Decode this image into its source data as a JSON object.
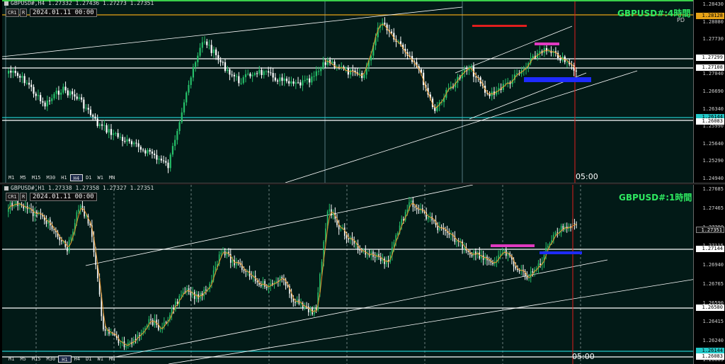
{
  "panels": [
    {
      "header": "GBPUSD#,H4  1.27332 1.27436 1.27273 1.27351",
      "chip_cr": "CR1",
      "chip_r": "R",
      "date": "2024.01.11 00:00",
      "title": "GBPUSD#:4時間",
      "pd": "PD",
      "time": "05:00",
      "timeframes": [
        "M1",
        "M5",
        "M15",
        "M30",
        "H1",
        "H4",
        "D1",
        "W1",
        "MN"
      ],
      "active_tf": "H4",
      "ticks": [
        "1.28430",
        "1.28080",
        "1.27730",
        "1.27380",
        "1.27040",
        "1.26690",
        "1.26340",
        "1.25990",
        "1.25640",
        "1.25290",
        "1.24940"
      ],
      "tags": [
        {
          "text": "1.28128",
          "color": "y"
        },
        {
          "text": "1.27299",
          "color": "w"
        },
        {
          "text": "1.27108",
          "color": "w"
        },
        {
          "text": "1.26144",
          "color": "c"
        },
        {
          "text": "1.26083",
          "color": "w"
        }
      ]
    },
    {
      "header": "GBPUSD#,H1  1.27338 1.27358 1.27327 1.27351",
      "chip_cr": "CR1",
      "chip_r": "R",
      "date": "2024.01.11 00:00",
      "title": "GBPUSD#:1時間",
      "time": "05:00",
      "timeframes": [
        "M1",
        "M5",
        "M15",
        "M30",
        "H1",
        "H4",
        "D1",
        "W1",
        "MN"
      ],
      "active_tf": "H1",
      "ticks": [
        "1.27685",
        "1.27465",
        "1.27290",
        "1.27115",
        "1.26940",
        "1.26765",
        "1.26590",
        "1.26415",
        "1.26240",
        "1.26065"
      ],
      "tags": [
        {
          "text": "1.27351",
          "color": "k"
        },
        {
          "text": "1.27144",
          "color": "w"
        },
        {
          "text": "1.26580",
          "color": "w"
        },
        {
          "text": "1.26144",
          "color": "c"
        },
        {
          "text": "1.26083",
          "color": "w"
        }
      ]
    }
  ],
  "colors": {
    "bull": "#26c06a",
    "bear": "#ffffff",
    "bg": "#021a17",
    "hline": "#ffffff",
    "cyanline": "#22c7c7",
    "orangeline": "#e8a317",
    "ma": "#e8952a",
    "red": "#e01e1e",
    "magenta": "#e03ac0",
    "blue": "#1e2bff"
  }
}
